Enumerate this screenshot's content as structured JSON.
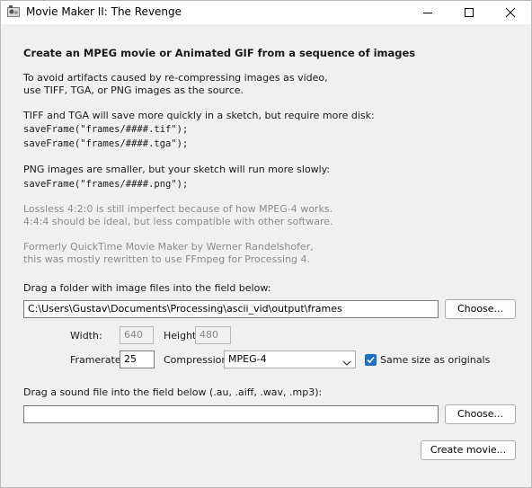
{
  "window": {
    "title": "Movie Maker II: The Revenge",
    "controls": {
      "minimize": "minimize-icon",
      "maximize": "maximize-icon",
      "close": "close-icon"
    }
  },
  "info": {
    "heading": "Create an MPEG movie or Animated GIF from a sequence of images",
    "avoid_line1": "To avoid artifacts caused by re-compressing images as video,",
    "avoid_line2": "use TIFF, TGA, or PNG images as the source.",
    "tiff_line": "TIFF and TGA will save more quickly in a sketch, but require more disk:",
    "tiff_code1": "saveFrame(\"frames/####.tif\");",
    "tiff_code2": "saveFrame(\"frames/####.tga\");",
    "png_line": "PNG images are smaller, but your sketch will run more slowly:",
    "png_code": "saveFrame(\"frames/####.png\");",
    "lossless_line1": "Lossless 4:2:0 is still imperfect because of how MPEG-4 works.",
    "lossless_line2": "4:4:4 should be ideal, but less compatible with other software.",
    "credit_line1": "Formerly QuickTime Movie Maker by Werner Randelshofer,",
    "credit_line2": "this was mostly rewritten to use FFmpeg for Processing 4."
  },
  "image_section": {
    "label": "Drag a folder with image files into the field below:",
    "path_value": "C:\\Users\\Gustav\\Documents\\Processing\\ascii_vid\\output\\frames",
    "choose_label": "Choose..."
  },
  "settings": {
    "width_label": "Width:",
    "width_value": "640",
    "height_label": "Height:",
    "height_value": "480",
    "framerate_label": "Framerate:",
    "framerate_value": "25",
    "compression_label": "Compression:",
    "compression_value": "MPEG-4",
    "same_size_label": "Same size as originals",
    "same_size_checked": true
  },
  "sound_section": {
    "label": "Drag a sound file into the field below (.au, .aiff, .wav, .mp3):",
    "path_value": "",
    "choose_label": "Choose..."
  },
  "create_button_label": "Create movie...",
  "colors": {
    "accent": "#1f6fc4",
    "window_bg": "#f0f0f0",
    "disabled_text": "#8c8c8c"
  }
}
